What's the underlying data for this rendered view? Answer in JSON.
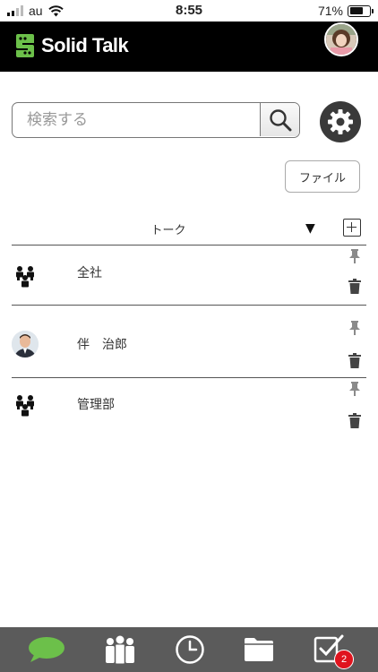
{
  "status_bar": {
    "carrier": "au",
    "time": "8:55",
    "battery_percent": "71%",
    "battery_level": 0.71
  },
  "header": {
    "app_name": "Solid Talk",
    "logo_icon": "solidtalk-logo-icon",
    "accent_color": "#6cc04a"
  },
  "search": {
    "placeholder": "検索する",
    "value": ""
  },
  "toolbar": {
    "file_label": "ファイル"
  },
  "talk_list": {
    "title": "トーク",
    "items": [
      {
        "name": "全社",
        "icon": "group-icon"
      },
      {
        "name": "伴　治郎",
        "icon": "avatar"
      },
      {
        "name": "管理部",
        "icon": "group-icon"
      }
    ]
  },
  "tab_bar": {
    "tabs": [
      {
        "icon": "chat-bubble-icon",
        "active": true
      },
      {
        "icon": "people-icon",
        "active": false
      },
      {
        "icon": "clock-icon",
        "active": false
      },
      {
        "icon": "folder-icon",
        "active": false
      },
      {
        "icon": "task-check-icon",
        "active": false
      }
    ],
    "task_badge": "2",
    "active_color": "#6cc04a",
    "badge_color": "#e0141e"
  }
}
